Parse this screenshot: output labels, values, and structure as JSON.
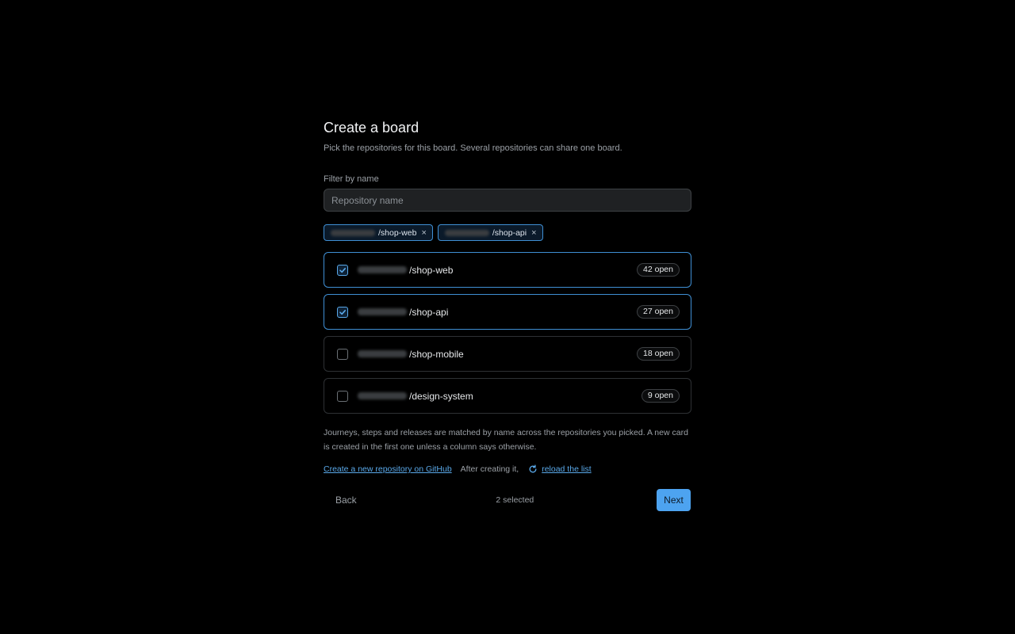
{
  "header": {
    "title": "Create a board",
    "subtitle": "Pick the repositories for this board. Several repositories can share one board."
  },
  "filter": {
    "label": "Filter by name",
    "placeholder": "Repository name",
    "value": ""
  },
  "chips": [
    {
      "name": "/shop-web",
      "remove_glyph": "×"
    },
    {
      "name": "/shop-api",
      "remove_glyph": "×"
    }
  ],
  "repos": [
    {
      "name": "/shop-web",
      "open": "42 open",
      "selected": true
    },
    {
      "name": "/shop-api",
      "open": "27 open",
      "selected": true
    },
    {
      "name": "/shop-mobile",
      "open": "18 open",
      "selected": false
    },
    {
      "name": "/design-system",
      "open": "9 open",
      "selected": false
    }
  ],
  "note": "Journeys, steps and releases are matched by name across the repositories you picked. A new card is created in the first one unless a column says otherwise.",
  "links": {
    "create_repo": "Create a new repository on GitHub",
    "after_text": "After creating it,",
    "reload": "reload the list",
    "reload_icon": "refresh-icon"
  },
  "footer": {
    "back_label": "Back",
    "selected_count": "2 selected",
    "next_label": "Next"
  },
  "colors": {
    "background": "#000000",
    "accent": "#4da3f0",
    "selected_border": "#3f8fd4"
  }
}
